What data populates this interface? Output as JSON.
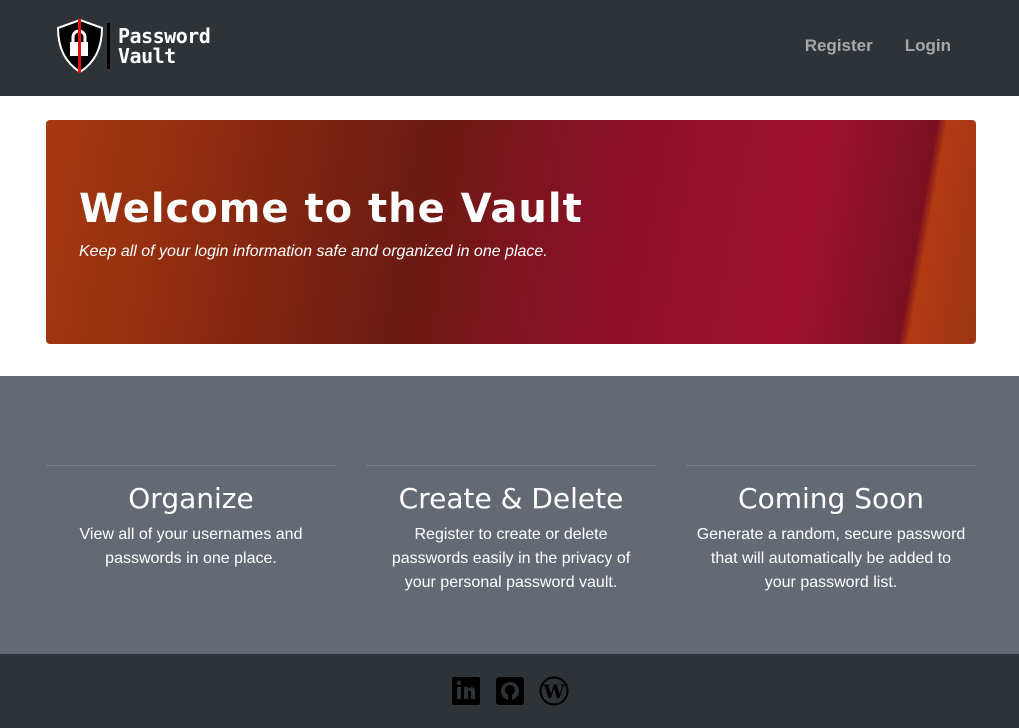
{
  "nav": {
    "brand_line1": "Password",
    "brand_line2": "Vault",
    "links": [
      "Register",
      "Login"
    ]
  },
  "hero": {
    "title": "Welcome to the Vault",
    "subtitle": "Keep all of your login information safe and organized in one place."
  },
  "features": [
    {
      "title": "Organize",
      "text": "View all of your usernames and passwords in one place."
    },
    {
      "title": "Create & Delete",
      "text": "Register to create or delete passwords easily in the privacy of your personal password vault."
    },
    {
      "title": "Coming Soon",
      "text": "Generate a random, secure password that will automatically be added to your password list."
    }
  ],
  "footer": {
    "icons": [
      "linkedin-icon",
      "github-icon",
      "wordpress-icon"
    ]
  }
}
